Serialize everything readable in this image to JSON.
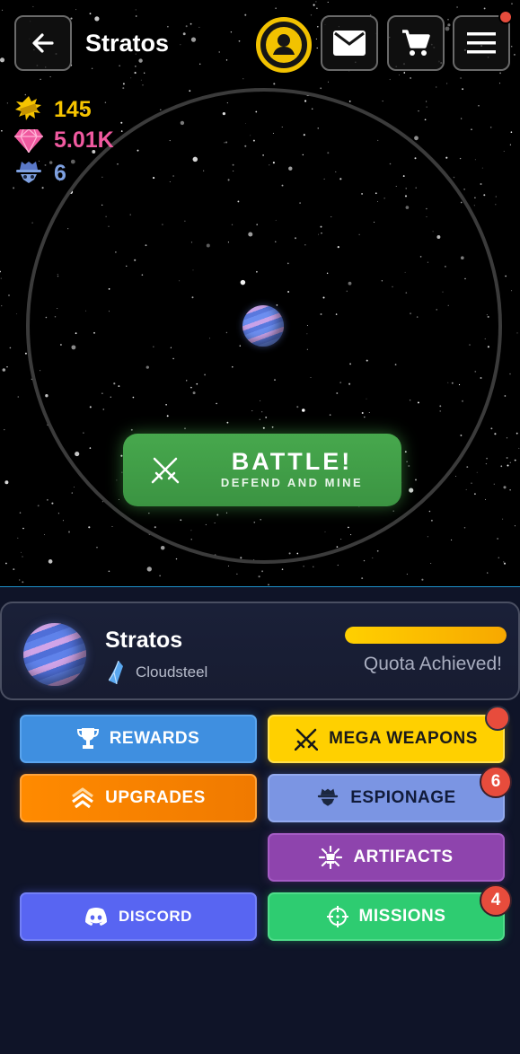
{
  "header": {
    "title": "Stratos",
    "has_notification": true
  },
  "resources": {
    "gold": "145",
    "gems": "5.01K",
    "spies": "6"
  },
  "battle": {
    "title": "BATTLE!",
    "subtitle": "DEFEND AND MINE"
  },
  "planet_card": {
    "name": "Stratos",
    "resource": "Cloudsteel",
    "quota_progress": 1.0,
    "quota_text": "Quota Achieved!"
  },
  "actions": {
    "rewards": "REWARDS",
    "upgrades": "UPGRADES",
    "discord": "DISCORD",
    "mega_weapons": "MEGA WEAPONS",
    "espionage": "ESPIONAGE",
    "espionage_badge": "6",
    "artifacts": "ARTIFACTS",
    "missions": "MISSIONS",
    "missions_badge": "4"
  },
  "icons": {
    "back": "back-arrow-icon",
    "profile": "profile-icon",
    "mail": "mail-icon",
    "cart": "cart-icon",
    "menu": "menu-icon",
    "gold": "gold-bars-icon",
    "gem": "gem-icon",
    "spy": "spy-icon",
    "battle": "crossed-swords-icon",
    "cloudsteel": "crystal-icon",
    "rewards": "trophy-icon",
    "upgrades": "chevrons-up-icon",
    "discord": "discord-icon",
    "mega_weapons": "crossed-swords-icon",
    "espionage": "spy-icon",
    "artifacts": "artifact-icon",
    "missions": "crosshair-icon"
  },
  "colors": {
    "gold": "#f6c400",
    "gem": "#f05aa0",
    "spy": "#7ea0e0",
    "battle": "#47a84d",
    "rewards": "#3f8fe0",
    "upgrades": "#ff8a00",
    "discord": "#5865f2",
    "mega_weapons": "#ffd000",
    "espionage": "#7b95e3",
    "artifacts": "#8e44ad",
    "missions": "#2ecc71",
    "badge": "#e74c3c"
  }
}
